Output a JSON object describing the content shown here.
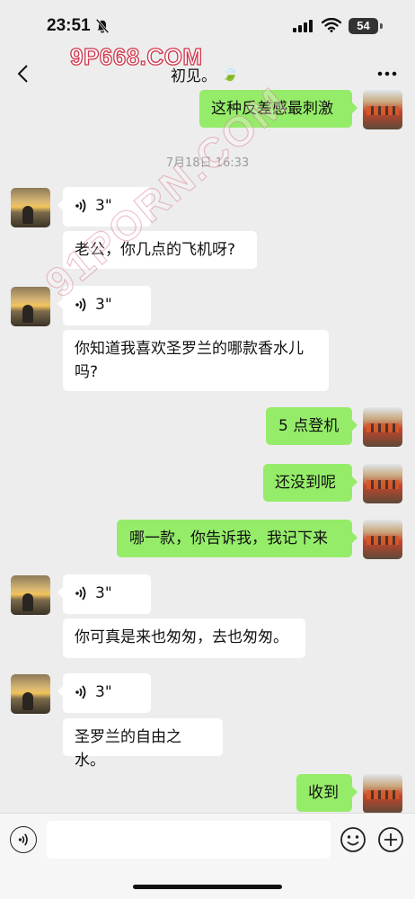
{
  "status": {
    "time": "23:51",
    "battery": "54"
  },
  "nav": {
    "title": "初见。",
    "title_emoji": "🍃"
  },
  "watermarks": {
    "top": "9P668.COM",
    "diagonal": "91PORN.COM"
  },
  "timestamp": "7月18日 16:33",
  "messages": [
    {
      "from": "me",
      "type": "text",
      "text": "这种反差感最刺激"
    },
    {
      "from": "her",
      "type": "voice",
      "duration": "3\""
    },
    {
      "from": "her",
      "type": "text",
      "text": "老公，你几点的飞机呀?"
    },
    {
      "from": "her",
      "type": "voice",
      "duration": "3\""
    },
    {
      "from": "her",
      "type": "text",
      "text": "你知道我喜欢圣罗兰的哪款香水儿吗?"
    },
    {
      "from": "me",
      "type": "text",
      "text": "5 点登机"
    },
    {
      "from": "me",
      "type": "text",
      "text": "还没到呢"
    },
    {
      "from": "me",
      "type": "text",
      "text": "哪一款，你告诉我，我记下来"
    },
    {
      "from": "her",
      "type": "voice",
      "duration": "3\""
    },
    {
      "from": "her",
      "type": "text",
      "text": "你可真是来也匆匆，去也匆匆。"
    },
    {
      "from": "her",
      "type": "voice",
      "duration": "3\""
    },
    {
      "from": "her",
      "type": "text",
      "text": "圣罗兰的自由之水。"
    },
    {
      "from": "me",
      "type": "text",
      "text": "收到"
    }
  ],
  "input": {
    "value": "",
    "placeholder": ""
  },
  "icons": {
    "back": "chevron-left-icon",
    "more": "more-dots-icon",
    "voice_toggle": "voice-input-icon",
    "emoji": "emoji-icon",
    "plus": "plus-icon",
    "voice_message": "voice-wave-icon"
  },
  "colors": {
    "background": "#ededed",
    "out_bubble": "#95ec69",
    "in_bubble": "#ffffff",
    "timestamp": "#9a9a9a"
  }
}
